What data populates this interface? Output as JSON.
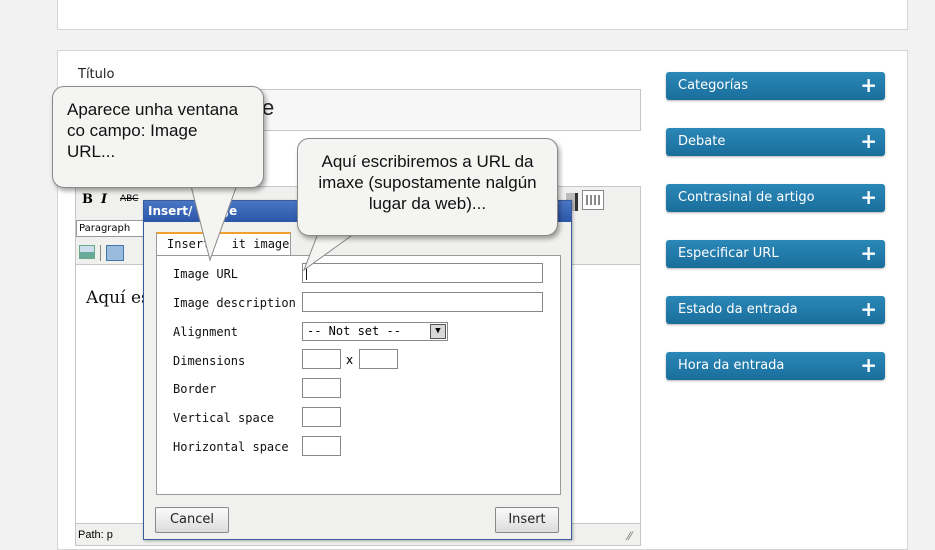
{
  "post_editor": {
    "title_label": "Título",
    "title_value_tail": "e",
    "body_text_partial": "Aquí es",
    "path_label": "Path: p",
    "toolbar": {
      "bold": "B",
      "italic": "I",
      "strikethrough": "ABC",
      "format_select": "Paragraph"
    }
  },
  "sidebar": {
    "items": [
      {
        "label": "Categorías",
        "icon": "plus-icon"
      },
      {
        "label": "Debate",
        "icon": "plus-icon"
      },
      {
        "label": "Contrasinal de artigo",
        "icon": "plus-icon"
      },
      {
        "label": "Especificar URL",
        "icon": "plus-icon"
      },
      {
        "label": "Estado da entrada",
        "icon": "plus-icon"
      },
      {
        "label": "Hora da entrada",
        "icon": "plus-icon"
      }
    ],
    "plus_glyph": "+"
  },
  "dialog": {
    "title_left": "Insert/",
    "title_right": "age",
    "tab_left": "Insert/",
    "tab_right": "it image",
    "fields": {
      "image_url_label": "Image URL",
      "image_url_value": "",
      "image_description_label": "Image description",
      "image_description_value": "",
      "alignment_label": "Alignment",
      "alignment_value": "-- Not set --",
      "dimensions_label": "Dimensions",
      "dimensions_separator": "x",
      "border_label": "Border",
      "vertical_space_label": "Vertical space",
      "horizontal_space_label": "Horizontal space"
    },
    "cancel_label": "Cancel",
    "insert_label": "Insert"
  },
  "callouts": {
    "left": "Aparece unha ventana co campo: Image URL...",
    "right": "Aquí escribiremos a URL da imaxe (supostamente nalgún lugar da web)..."
  },
  "colors": {
    "sidebar_header": "#1a6e9b",
    "dialog_title": "#2b56a8",
    "tab_accent": "#f0a030"
  }
}
